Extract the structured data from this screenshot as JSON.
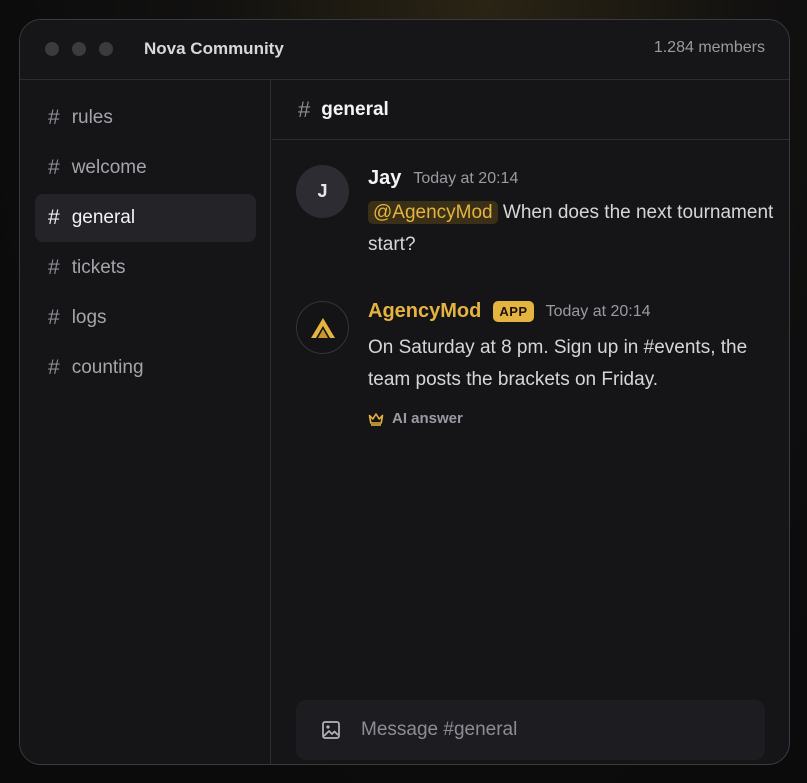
{
  "window": {
    "server_name": "Nova Community",
    "members": "1.284 members"
  },
  "sidebar": {
    "channels": [
      {
        "name": "rules",
        "active": false
      },
      {
        "name": "welcome",
        "active": false
      },
      {
        "name": "general",
        "active": true
      },
      {
        "name": "tickets",
        "active": false
      },
      {
        "name": "logs",
        "active": false
      },
      {
        "name": "counting",
        "active": false
      }
    ],
    "hash_symbol": "#"
  },
  "channel_header": {
    "hash": "#",
    "title": "general"
  },
  "messages": [
    {
      "avatar_initial": "J",
      "author": "Jay",
      "timestamp": "Today at 20:14",
      "mention": "@AgencyMod",
      "text": " When does the next tournament start?"
    },
    {
      "avatar_icon": "agency-logo-icon",
      "author": "AgencyMod",
      "badge": "APP",
      "timestamp": "Today at 20:14",
      "text": "On Saturday at 8 pm. Sign up in #events, the team posts the brackets on Friday.",
      "footer_label": "AI answer",
      "footer_icon": "crown-icon"
    }
  ],
  "composer": {
    "placeholder": "Message #general",
    "attach_icon": "image-icon"
  },
  "colors": {
    "accent_gold": "#e5b33f",
    "background": "#151518",
    "active_channel": "#232328"
  }
}
